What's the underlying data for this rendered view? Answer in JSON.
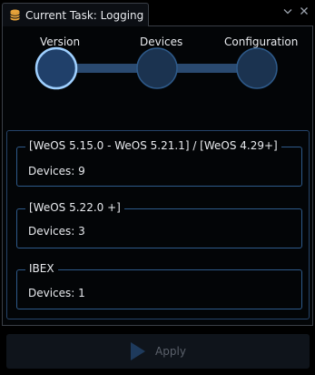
{
  "window": {
    "tab_title": "Current Task: Logging",
    "controls": {
      "dropdown_icon": "chevron-down-icon",
      "close_icon": "close-icon"
    }
  },
  "stepper": {
    "steps": [
      {
        "label": "Version",
        "state": "active"
      },
      {
        "label": "Devices",
        "state": "pending"
      },
      {
        "label": "Configuration",
        "state": "pending"
      }
    ]
  },
  "groups": [
    {
      "title": "[WeOS 5.15.0 - WeOS 5.21.1] / [WeOS 4.29+]",
      "devices": "Devices: 9"
    },
    {
      "title": "[WeOS 5.22.0 +]",
      "devices": "Devices: 3"
    },
    {
      "title": "IBEX",
      "devices": "Devices: 1"
    }
  ],
  "apply_button": {
    "label": "Apply",
    "icon": "play-icon",
    "enabled": false
  },
  "colors": {
    "accent": "#2e5a8a",
    "step_active_ring": "#9fd0ff",
    "step_fill": "#1b3350",
    "connector": "#2a4a70",
    "tab_icon": "#e8a33a"
  }
}
